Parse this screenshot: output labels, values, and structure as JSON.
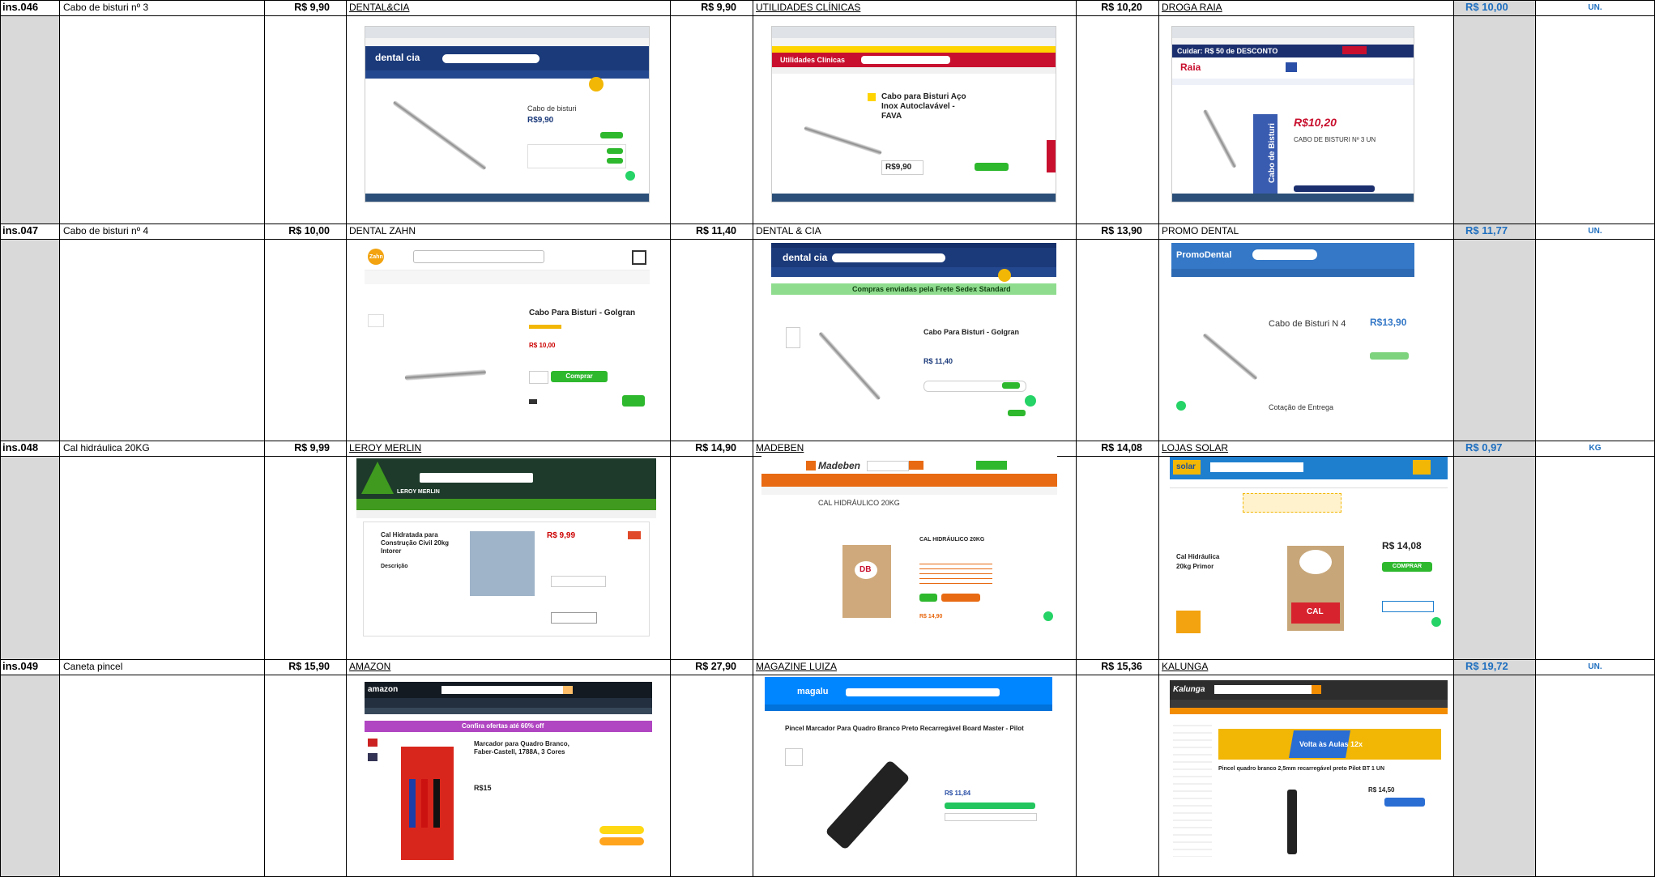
{
  "rows": [
    {
      "code": "ins.046",
      "description": "Cabo de bisturi nº 3",
      "prices": [
        "R$ 9,90",
        "R$ 9,90",
        "R$ 10,20"
      ],
      "stores": [
        "DENTAL&CIA",
        "UTILIDADES CLÍNICAS",
        "DROGA RAIA"
      ],
      "average": "R$ 10,00",
      "unit": "UN.",
      "shots": [
        {
          "brand": "dental cia",
          "title": "Cabo de bisturi",
          "price": "R$9,90"
        },
        {
          "brand": "Utilidades Clínicas",
          "title": "Cabo para Bisturi Aço Inox Autoclavável - FAVA",
          "price": "R$9,90"
        },
        {
          "brand": "Raia",
          "title": "CABO DE BISTURI Nº 3 UN",
          "price": "R$10,20",
          "promo": "Cuidar: R$ 50 de DESCONTO",
          "box_label": "Cabo de Bisturi"
        }
      ]
    },
    {
      "code": "ins.047",
      "description": "Cabo de bisturi nº 4",
      "prices": [
        "R$ 10,00",
        "R$ 11,40",
        "R$ 13,90"
      ],
      "stores": [
        "DENTAL ZAHN",
        "DENTAL & CIA",
        "PROMO DENTAL"
      ],
      "average": "R$ 11,77",
      "unit": "UN.",
      "shots": [
        {
          "brand": "Zahn",
          "title": "Cabo Para Bisturi - Golgran",
          "price": "R$ 10,00",
          "button": "Comprar"
        },
        {
          "brand": "dental cia",
          "title": "Cabo Para Bisturi - Golgran",
          "price": "R$ 11,40",
          "banner": "Compras enviadas pela Frete Sedex Standard"
        },
        {
          "brand": "PromoDental",
          "title": "Cabo de Bisturi N 4",
          "price": "R$13,90",
          "subtitle": "Cotação de Entrega"
        }
      ]
    },
    {
      "code": "ins.048",
      "description": "Cal hidráulica 20KG",
      "prices": [
        "R$ 9,99",
        "R$ 14,90",
        "R$ 14,08"
      ],
      "stores": [
        "LEROY MERLIN",
        "MADEBEN",
        "LOJAS SOLAR"
      ],
      "average": "R$ 0,97",
      "unit": "KG",
      "shots": [
        {
          "brand": "LEROY MERLIN",
          "title": "Cal Hidratada para Construção Civil 20kg Intorer",
          "price": "R$ 9,99",
          "subtitle": "Descrição"
        },
        {
          "brand": "Madeben",
          "title": "CAL HIDRÁULICO 20KG",
          "price": "R$ 14,90",
          "bag": "DB"
        },
        {
          "brand": "solar",
          "title": "Cal Hidráulica 20kg Primor",
          "price": "R$ 14,08",
          "button": "COMPRAR",
          "bag": "CAL"
        }
      ]
    },
    {
      "code": "ins.049",
      "description": "Caneta pincel",
      "prices": [
        "R$ 15,90",
        "R$ 27,90",
        "R$ 15,36"
      ],
      "stores": [
        "AMAZON",
        "MAGAZINE LUIZA",
        "KALUNGA"
      ],
      "average": "R$ 19,72",
      "unit": "UN.",
      "shots": [
        {
          "brand": "amazon",
          "title": "Marcador para Quadro Branco, Faber-Castell, 1788A, 3 Cores",
          "price": "R$15",
          "banner": "Confira ofertas até 60% off"
        },
        {
          "brand": "magalu",
          "title": "Pincel Marcador Para Quadro Branco Preto Recarregável Board Master - Pilot",
          "price": "R$ 11,84"
        },
        {
          "brand": "Kalunga",
          "title": "Pincel quadro branco 2,5mm recarregável preto Pilot BT 1 UN",
          "price": "R$ 14,50",
          "banner": "Volta às Aulas 12x"
        }
      ]
    }
  ],
  "colors": {
    "grid": "#000000",
    "grey_column": "#d9d9d9",
    "average_text": "#1f6fbf",
    "dental_blue": "#1b3a7a",
    "green_button": "#2eb82e",
    "red_brand": "#c8102e",
    "leroy_green": "#3f9a1f",
    "madeben_orange": "#e86a12",
    "solar_blue": "#1e7fcf",
    "amazon_dark": "#232f3e",
    "magalu_blue": "#0086ff",
    "kalunga_dark": "#2d2d2d"
  }
}
